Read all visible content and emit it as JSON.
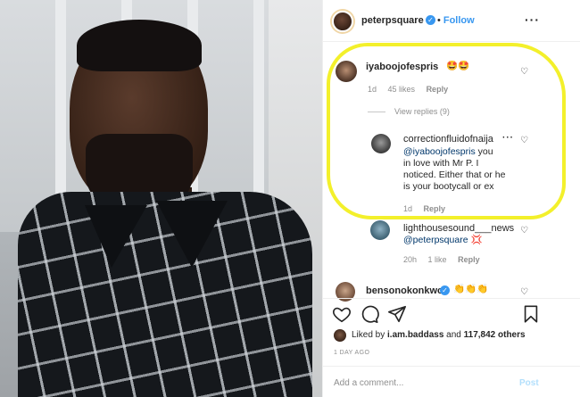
{
  "header": {
    "username": "peterpsquare",
    "follow_label": "Follow",
    "separator": "•",
    "more": "···"
  },
  "comments": [
    {
      "username": "iyaboojofespris",
      "text": "🤩🤩",
      "meta": {
        "time": "1d",
        "likes": "45 likes",
        "reply": "Reply"
      },
      "view_replies": "View replies (9)"
    }
  ],
  "replies": [
    {
      "username": "correctionfluidofnaija",
      "mention": "@iyaboojofespris",
      "text_lines": [
        "you",
        "in love with Mr P. I",
        "noticed. Either that or he",
        "is your bootycall or ex"
      ],
      "meta": {
        "time": "1d",
        "reply": "Reply"
      }
    },
    {
      "username": "lighthousesound___news",
      "mention": "@peterpsquare",
      "text": "💢",
      "meta": {
        "time": "20h",
        "likes": "1 like",
        "reply": "Reply"
      }
    }
  ],
  "next_comment": {
    "username": "bensonokonkwo",
    "text": "👏👏👏"
  },
  "likes": {
    "prefix": "Liked by",
    "user": "i.am.baddass",
    "connector": "and",
    "count": "117,842 others"
  },
  "date": "1 DAY AGO",
  "add_comment": {
    "placeholder": "Add a comment...",
    "post_label": "Post"
  },
  "icons": [
    "heart-icon",
    "comment-icon",
    "share-icon",
    "bookmark-icon",
    "verified-icon",
    "more-icon"
  ],
  "colors": {
    "highlight": "#f3f02b",
    "link_blue": "#3897f0",
    "verified_blue": "#3897f0",
    "muted": "#8e8e8e"
  }
}
